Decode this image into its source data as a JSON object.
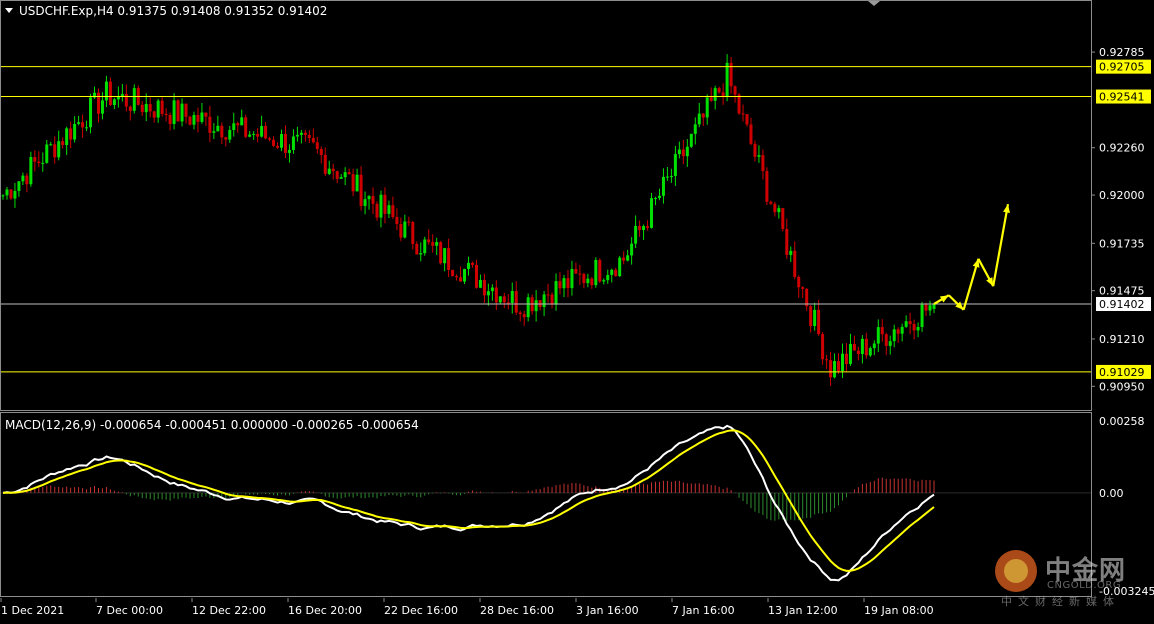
{
  "header": {
    "symbol_line": "USDCHF.Exp,H4  0.91375 0.91408 0.91352 0.91402"
  },
  "macd": {
    "label": "MACD(12,26,9) -0.000654 -0.000451 0.000000 -0.000265 -0.000654"
  },
  "watermark": {
    "cn": "中金网",
    "en": "CNGOLD.ORG",
    "sub": "中文财经新媒体"
  },
  "colors": {
    "bull": "#00e000",
    "bear": "#d00000",
    "hline": "#ffff00",
    "price_line": "#c0c0c0",
    "macd_line": "#ffffff",
    "signal_line": "#ffff00",
    "arrow": "#ffff00"
  },
  "chart_data": [
    {
      "type": "candlestick",
      "title": "USDCHF.Exp,H4",
      "ohlc_last": {
        "open": 0.91375,
        "high": 0.91408,
        "low": 0.91352,
        "close": 0.91402
      },
      "ylim": [
        0.9082,
        0.9306
      ],
      "y_ticks": [
        "0.92785",
        "0.92260",
        "0.92000",
        "0.91735",
        "0.91475",
        "0.91210",
        "0.90950"
      ],
      "x_ticks": [
        "1 Dec 2021",
        "7 Dec 00:00",
        "12 Dec 22:00",
        "16 Dec 20:00",
        "22 Dec 16:00",
        "28 Dec 16:00",
        "3 Jan 16:00",
        "7 Jan 16:00",
        "13 Jan 12:00",
        "19 Jan 08:00"
      ],
      "horizontal_levels": [
        {
          "value": 0.92705,
          "label": "0.92705"
        },
        {
          "value": 0.92541,
          "label": "0.92541"
        },
        {
          "value": 0.91029,
          "label": "0.91029"
        }
      ],
      "current_price": {
        "value": 0.91402,
        "label": "0.91402"
      },
      "key_closes": [
        {
          "date": "1 Dec 2021",
          "close": 0.92
        },
        {
          "date": "7 Dec 00:00",
          "close": 0.9255
        },
        {
          "date": "12 Dec 22:00",
          "close": 0.924
        },
        {
          "date": "16 Dec 20:00",
          "close": 0.9225
        },
        {
          "date": "22 Dec 16:00",
          "close": 0.9175
        },
        {
          "date": "28 Dec 16:00",
          "close": 0.914
        },
        {
          "date": "3 Jan 16:00",
          "close": 0.9165
        },
        {
          "date": "7 Jan 16:00",
          "close": 0.9265
        },
        {
          "date": "13 Jan 12:00",
          "close": 0.9105
        },
        {
          "date": "19 Jan 08:00",
          "close": 0.914
        }
      ],
      "forecast_path": [
        0.91402,
        0.9145,
        0.9137,
        0.9165,
        0.915,
        0.9195
      ]
    },
    {
      "type": "macd",
      "params": "12,26,9",
      "ylim": [
        -0.00345,
        0.00258
      ],
      "y_ticks": [
        "0.00258",
        "0.00",
        "-0.003245"
      ],
      "values": {
        "macd": -0.000654,
        "signal": -0.000451
      }
    }
  ]
}
